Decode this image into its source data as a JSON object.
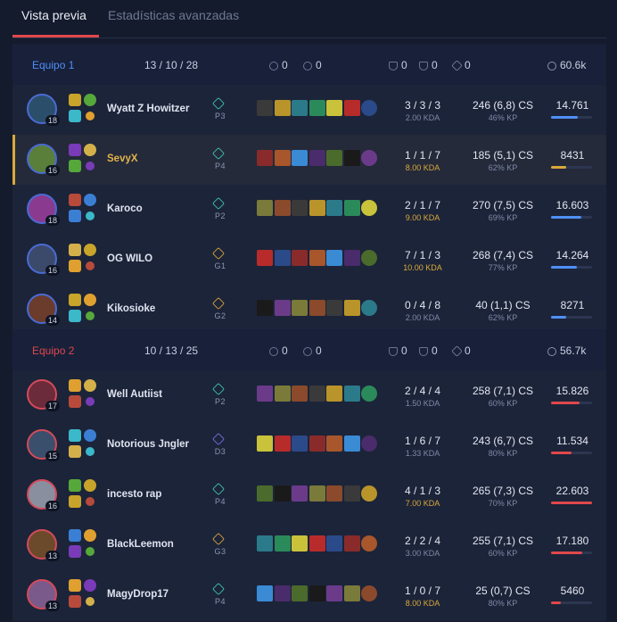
{
  "tabs": {
    "overview": "Vista previa",
    "advanced": "Estadísticas avanzadas"
  },
  "colors": {
    "team1": "#4f8ff7",
    "team2": "#e0484b",
    "gold": "#d9a93a"
  },
  "teams": [
    {
      "name": "Equipo 1",
      "score": "13 / 10 / 28",
      "turrets": "0",
      "inhibs": "0",
      "barons": "0",
      "heralds": "0",
      "dragons": "0",
      "gold": "60.6k",
      "players": [
        {
          "level": "18",
          "name": "Wyatt Z Howitzer",
          "rank": "P3",
          "kda": "3 / 3 / 3",
          "kda_ratio": "2.00 KDA",
          "cs": "246 (6,8) CS",
          "kp": "46% KP",
          "damage": "14.761",
          "damage_fraction": 0.65
        },
        {
          "level": "16",
          "name": "SevyX",
          "rank": "P4",
          "kda": "1 / 1 / 7",
          "kda_ratio": "8.00 KDA",
          "cs": "185 (5,1) CS",
          "kp": "62% KP",
          "damage": "8431",
          "damage_fraction": 0.37
        },
        {
          "level": "18",
          "name": "Karoco",
          "rank": "P2",
          "kda": "2 / 1 / 7",
          "kda_ratio": "9.00 KDA",
          "cs": "270 (7,5) CS",
          "kp": "69% KP",
          "damage": "16.603",
          "damage_fraction": 0.73
        },
        {
          "level": "16",
          "name": "OG WILO",
          "rank": "G1",
          "kda": "7 / 1 / 3",
          "kda_ratio": "10.00 KDA",
          "cs": "268 (7,4) CS",
          "kp": "77% KP",
          "damage": "14.264",
          "damage_fraction": 0.63
        },
        {
          "level": "14",
          "name": "Kikosioke",
          "rank": "G2",
          "kda": "0 / 4 / 8",
          "kda_ratio": "2.00 KDA",
          "cs": "40 (1,1) CS",
          "kp": "62% KP",
          "damage": "8271",
          "damage_fraction": 0.36
        }
      ]
    },
    {
      "name": "Equipo 2",
      "score": "10 / 13 / 25",
      "turrets": "0",
      "inhibs": "0",
      "barons": "0",
      "heralds": "0",
      "dragons": "0",
      "gold": "56.7k",
      "players": [
        {
          "level": "17",
          "name": "Well Autiist",
          "rank": "P2",
          "kda": "2 / 4 / 4",
          "kda_ratio": "1.50 KDA",
          "cs": "258 (7,1) CS",
          "kp": "60% KP",
          "damage": "15.826",
          "damage_fraction": 0.7
        },
        {
          "level": "15",
          "name": "Notorious Jngler",
          "rank": "D3",
          "kda": "1 / 6 / 7",
          "kda_ratio": "1.33 KDA",
          "cs": "243 (6,7) CS",
          "kp": "80% KP",
          "damage": "11.534",
          "damage_fraction": 0.51
        },
        {
          "level": "16",
          "name": "incesto rap",
          "rank": "P4",
          "kda": "4 / 1 / 3",
          "kda_ratio": "7.00 KDA",
          "cs": "265 (7,3) CS",
          "kp": "70% KP",
          "damage": "22.603",
          "damage_fraction": 1.0
        },
        {
          "level": "13",
          "name": "BlackLeemon",
          "rank": "G3",
          "kda": "2 / 2 / 4",
          "kda_ratio": "3.00 KDA",
          "cs": "255 (7,1) CS",
          "kp": "60% KP",
          "damage": "17.180",
          "damage_fraction": 0.76
        },
        {
          "level": "13",
          "name": "MagyDrop17",
          "rank": "P4",
          "kda": "1 / 0 / 7",
          "kda_ratio": "8.00 KDA",
          "cs": "25 (0,7) CS",
          "kp": "80% KP",
          "damage": "5460",
          "damage_fraction": 0.24
        }
      ]
    }
  ]
}
